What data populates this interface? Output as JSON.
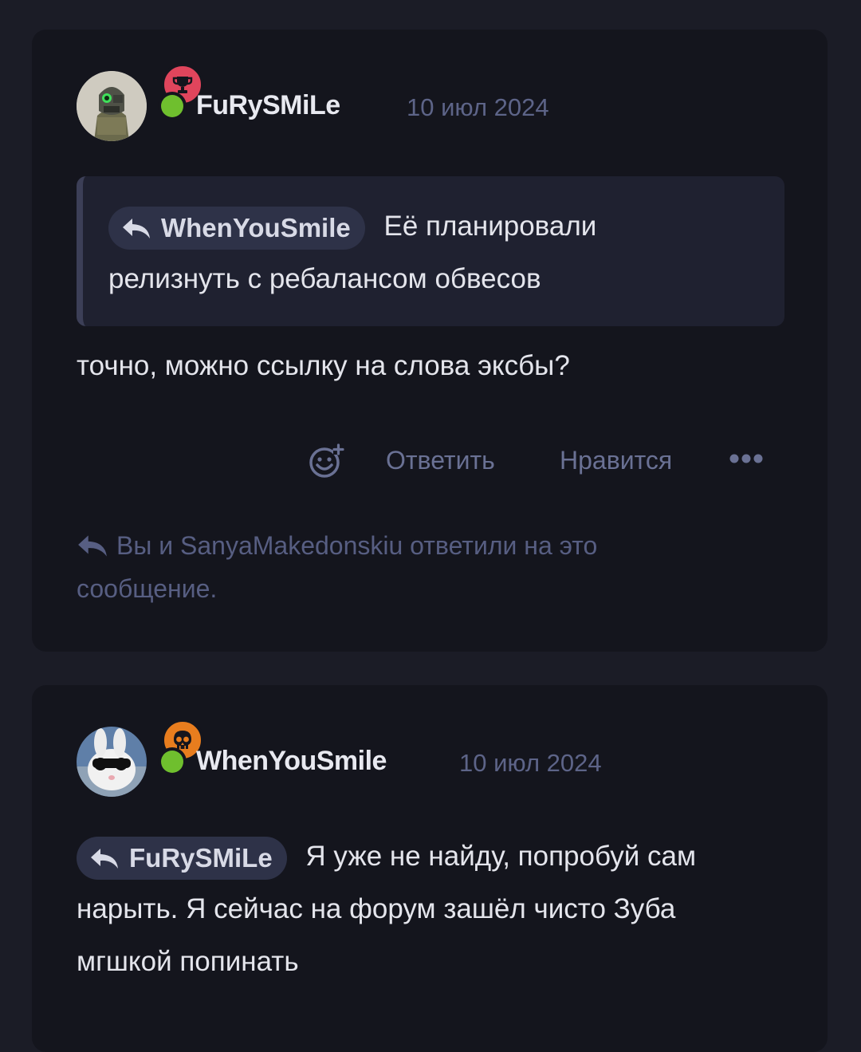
{
  "posts": [
    {
      "author": "FuRySMiLe",
      "date": "10 июл 2024",
      "badge_icon": "trophy-icon",
      "badge_color": "#e0455c",
      "online": true,
      "quote": {
        "mention": "WhenYouSmile",
        "text_line1": "Её планировали",
        "text_line2": "релизнуть с ребалансом обвесов"
      },
      "message": "точно, можно ссылку на слова эксбы?",
      "actions": {
        "reply": "Ответить",
        "like": "Нравится"
      },
      "replied_line1": "Вы и SanyaMakedonskiu ответили на это",
      "replied_line2": "сообщение."
    },
    {
      "author": "WhenYouSmile",
      "date": "10 июл 2024",
      "badge_icon": "skull-icon",
      "badge_color": "#e87d1e",
      "online": true,
      "mention": "FuRySMiLe",
      "message_line1": "Я уже не найду, попробуй сам",
      "message_line2": "нарыть. Я сейчас на форум зашёл чисто Зуба",
      "message_line3": "мгшкой попинать"
    }
  ]
}
